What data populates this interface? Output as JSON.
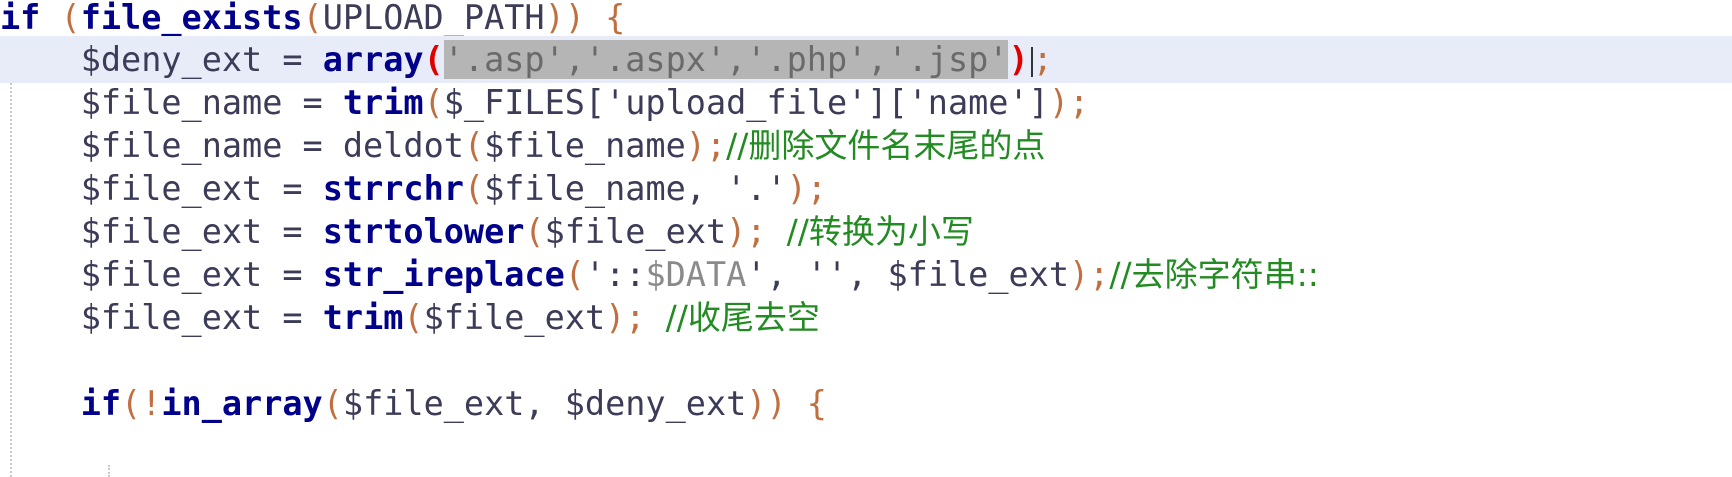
{
  "code": {
    "l1": {
      "kw_if": "if",
      "sp1": " ",
      "p_open": "(",
      "fn": "file_exists",
      "p2": "(",
      "arg": "UPLOAD_PATH",
      "p3": "))",
      "brace": " {"
    },
    "l2": {
      "indent": "    ",
      "var": "$deny_ext",
      "eq": " = ",
      "fn": "array",
      "p_open": "(",
      "selected": "'.asp','.aspx','.php','.jsp'",
      "p_close": ")",
      "semi": ";"
    },
    "l3": {
      "indent": "    ",
      "var": "$file_name",
      "eq": " = ",
      "fn": "trim",
      "p_open": "(",
      "arg": "$_FILES['upload_file']['name']",
      "p_close": ")",
      "semi": ";"
    },
    "l4": {
      "indent": "    ",
      "var": "$file_name",
      "eq": " = ",
      "fn": "deldot",
      "p_open": "(",
      "arg": "$file_name",
      "p_close": ")",
      "semi": ";",
      "comment": "//删除文件名末尾的点"
    },
    "l5": {
      "indent": "    ",
      "var": "$file_ext",
      "eq": " = ",
      "fn": "strrchr",
      "p_open": "(",
      "arg": "$file_name, '.'",
      "p_close": ")",
      "semi": ";"
    },
    "l6": {
      "indent": "    ",
      "var": "$file_ext",
      "eq": " = ",
      "fn": "strtolower",
      "p_open": "(",
      "arg": "$file_ext",
      "p_close": ")",
      "semi": "; ",
      "comment": "//转换为小写"
    },
    "l7": {
      "indent": "    ",
      "var": "$file_ext",
      "eq": " = ",
      "fn": "str_ireplace",
      "p_open": "(",
      "arg_a": "'::",
      "arg_b": "$DATA",
      "arg_c": "', '', $file_ext",
      "p_close": ")",
      "semi": ";",
      "comment": "//去除字符串::"
    },
    "l8": {
      "indent": "    ",
      "var": "$file_ext",
      "eq": " = ",
      "fn": "trim",
      "p_open": "(",
      "arg": "$file_ext",
      "p_close": ")",
      "semi": "; ",
      "comment": "//收尾去空"
    },
    "l10": {
      "indent": "    ",
      "kw_if": "if",
      "p_open": "(!",
      "fn": "in_array",
      "p2": "(",
      "arg": "$file_ext, $deny_ext",
      "p3": "))",
      "brace": " {"
    }
  },
  "colors": {
    "keyword": "#00008b",
    "comment": "#228b22",
    "current_line": "#e8ecf8",
    "selection": "#b5b5b5",
    "matching_paren": "#e00000"
  }
}
